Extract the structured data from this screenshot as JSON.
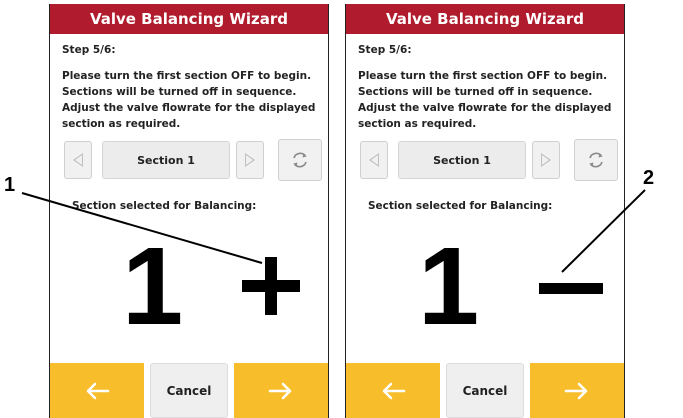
{
  "screens": [
    {
      "title": "Valve Balancing Wizard",
      "step": "Step 5/6:",
      "instructions": [
        "Please turn the first section OFF to begin.",
        "Sections will be turned off in sequence.",
        "Adjust the valve flowrate for the displayed",
        "section as required."
      ],
      "section_label": "Section 1",
      "selected_label": "Section selected for Balancing:",
      "section_number": "1",
      "indicator": "plus",
      "cancel_label": "Cancel"
    },
    {
      "title": "Valve Balancing Wizard",
      "step": "Step 5/6:",
      "instructions": [
        "Please turn the first section OFF to begin.",
        "Sections will be turned off in sequence.",
        "Adjust the valve flowrate for the displayed",
        "section as required."
      ],
      "section_label": "Section 1",
      "selected_label": "Section selected for Balancing:",
      "section_number": "1",
      "indicator": "minus",
      "cancel_label": "Cancel"
    }
  ],
  "callouts": [
    "1",
    "2"
  ],
  "colors": {
    "title_bar": "#b01c2e",
    "nav_button": "#f7bd2b",
    "button_grey": "#f1f1f1"
  },
  "icons": [
    "chevron-left-icon",
    "chevron-right-icon",
    "refresh-icon",
    "arrow-left-icon",
    "arrow-right-icon",
    "plus-icon",
    "minus-icon"
  ]
}
